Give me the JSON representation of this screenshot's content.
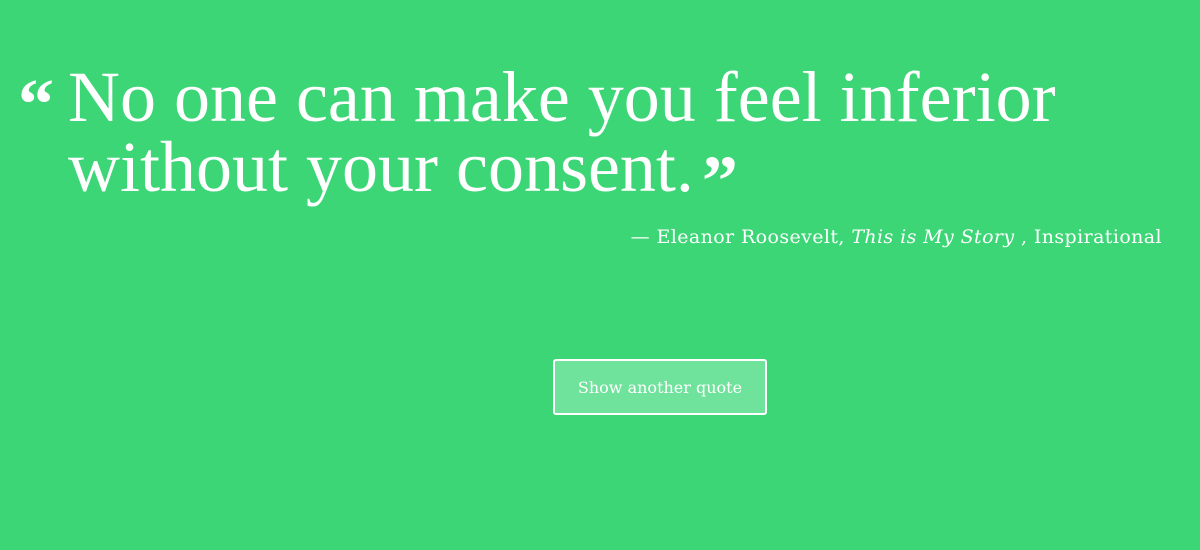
{
  "quote": {
    "open_mark": "“",
    "text": "No one can make you feel inferior without your consent.",
    "close_mark": "”"
  },
  "attribution": {
    "dash": "—",
    "author": "Eleanor Roosevelt,",
    "source": "This is My Story",
    "category": ", Inspirational"
  },
  "actions": {
    "show_another_label": "Show another quote"
  },
  "colors": {
    "background": "#3cd676",
    "text": "#ffffff",
    "button_fill": "#6fe29b"
  }
}
